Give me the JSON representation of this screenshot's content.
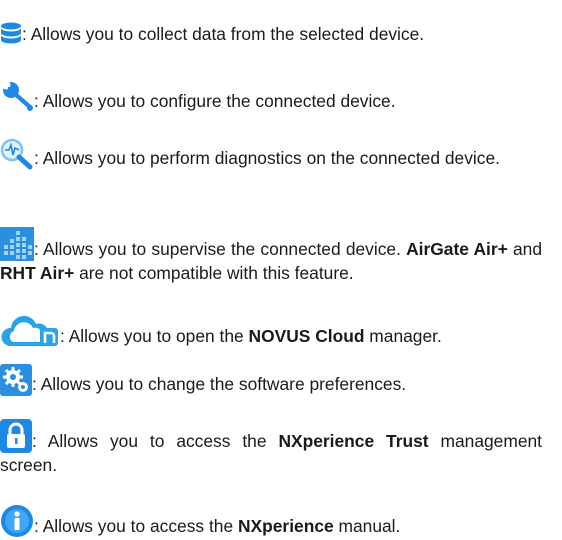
{
  "items": [
    {
      "id": "collect",
      "icon": "database-icon",
      "text": ": Allows you to collect data from the selected device."
    },
    {
      "id": "configure",
      "icon": "wrench-icon",
      "text": ": Allows you to configure the connected device."
    },
    {
      "id": "diagnostics",
      "icon": "diagnostics-magnifier-icon",
      "text": ": Allows you to perform diagnostics on the connected device."
    },
    {
      "id": "supervise",
      "icon": "supervision-grid-icon",
      "text_before": ": Allows you to supervise the connected device. ",
      "bold1": "AirGate Air+",
      "text_mid": " and ",
      "bold2": "RHT Air+",
      "text_after": " are not compatible with this feature."
    },
    {
      "id": "cloud",
      "icon": "novus-cloud-icon",
      "text_before": ": Allows you to open the ",
      "bold": "NOVUS Cloud",
      "text_after": " manager."
    },
    {
      "id": "preferences",
      "icon": "gears-icon",
      "text": ": Allows you to change the software preferences."
    },
    {
      "id": "trust",
      "icon": "padlock-icon",
      "text_before": ": Allows you to access the ",
      "bold": "NXperience Trust",
      "text_after": " management screen."
    },
    {
      "id": "manual",
      "icon": "info-icon",
      "text_before": ": Allows you to access the ",
      "bold": "NXperience",
      "text_after": " manual."
    }
  ],
  "colors": {
    "text": "#1a1a1a",
    "icon_blue": "#1e88e5",
    "icon_light": "#7cc4f5",
    "cloud_blue": "#29a3e8",
    "grid_blue": "#2b8fe0"
  }
}
